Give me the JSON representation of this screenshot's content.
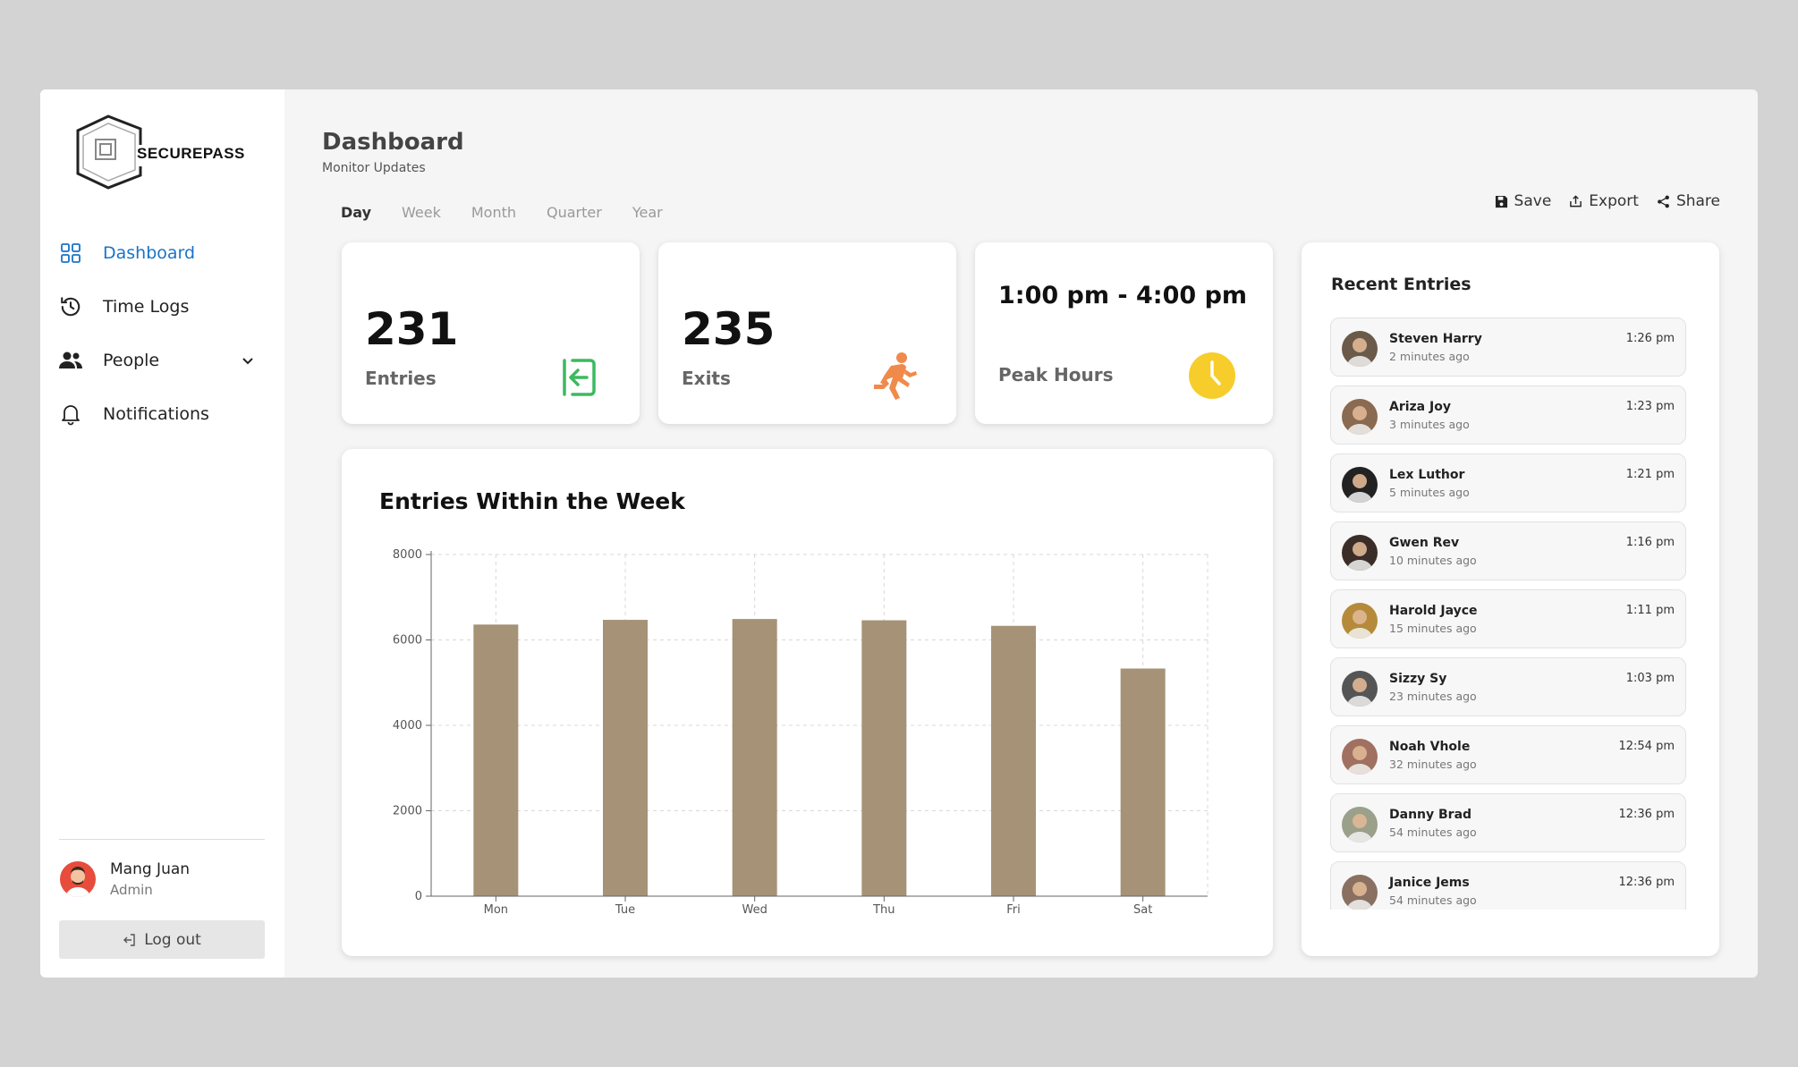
{
  "brand": {
    "name": "SECUREPASS"
  },
  "sidebar": {
    "items": [
      {
        "label": "Dashboard",
        "icon": "grid-icon",
        "active": true
      },
      {
        "label": "Time Logs",
        "icon": "history-icon"
      },
      {
        "label": "People",
        "icon": "people-icon",
        "has_dropdown": true
      },
      {
        "label": "Notifications",
        "icon": "bell-icon"
      }
    ],
    "user": {
      "name": "Mang Juan",
      "role": "Admin"
    },
    "logout_label": "Log out"
  },
  "header": {
    "title": "Dashboard",
    "subtitle": "Monitor Updates"
  },
  "tabs": [
    {
      "label": "Day",
      "active": true
    },
    {
      "label": "Week"
    },
    {
      "label": "Month"
    },
    {
      "label": "Quarter"
    },
    {
      "label": "Year"
    }
  ],
  "actions": {
    "save": "Save",
    "export": "Export",
    "share": "Share"
  },
  "stats": {
    "entries": {
      "value": "231",
      "label": "Entries",
      "icon": "enter-icon",
      "color": "#3cba5f"
    },
    "exits": {
      "value": "235",
      "label": "Exits",
      "icon": "running-icon",
      "color": "#f08a4b"
    },
    "peak": {
      "value": "1:00 pm - 4:00 pm",
      "label": "Peak Hours",
      "icon": "clock-icon",
      "color": "#f7cd2c"
    }
  },
  "chart_data": {
    "type": "bar",
    "title": "Entries Within the Week",
    "categories": [
      "Mon",
      "Tue",
      "Wed",
      "Thu",
      "Fri",
      "Sat"
    ],
    "values": [
      6360,
      6470,
      6490,
      6460,
      6330,
      5330
    ],
    "ylim": [
      0,
      8000
    ],
    "yticks": [
      0,
      2000,
      4000,
      6000,
      8000
    ],
    "grid": true,
    "bar_color": "#a69276"
  },
  "recent": {
    "title": "Recent Entries",
    "items": [
      {
        "name": "Steven Harry",
        "ago": "2 minutes ago",
        "time": "1:26 pm",
        "av": "#6b5a4a"
      },
      {
        "name": "Ariza Joy",
        "ago": "3 minutes ago",
        "time": "1:23 pm",
        "av": "#8a6a50"
      },
      {
        "name": "Lex Luthor",
        "ago": "5 minutes ago",
        "time": "1:21 pm",
        "av": "#222222"
      },
      {
        "name": "Gwen Rev",
        "ago": "10 minutes ago",
        "time": "1:16 pm",
        "av": "#3b2e28"
      },
      {
        "name": "Harold Jayce",
        "ago": "15 minutes ago",
        "time": "1:11 pm",
        "av": "#b58a3a"
      },
      {
        "name": "Sizzy Sy",
        "ago": "23 minutes ago",
        "time": "1:03 pm",
        "av": "#555555"
      },
      {
        "name": "Noah Vhole",
        "ago": "32 minutes ago",
        "time": "12:54 pm",
        "av": "#a07060"
      },
      {
        "name": "Danny Brad",
        "ago": "54 minutes ago",
        "time": "12:36 pm",
        "av": "#9aa08a"
      },
      {
        "name": "Janice Jems",
        "ago": "54 minutes ago",
        "time": "12:36 pm",
        "av": "#8a7060"
      }
    ]
  }
}
